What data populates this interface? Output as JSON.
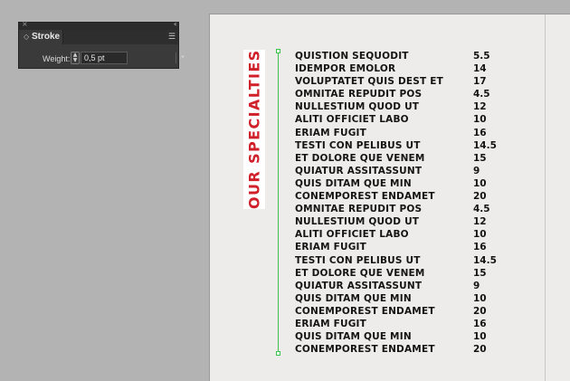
{
  "panel": {
    "title": "Stroke",
    "close_glyph": "×",
    "collapse_glyph": "‹‹",
    "tab_glyph": "◇",
    "menu_glyph": "☰",
    "weight_label": "Weight:",
    "stepper_up": "▲",
    "stepper_down": "▼",
    "weight_value": "0,5 pt",
    "dropdown_glyph": "▾"
  },
  "document": {
    "heading": "OUR SPECIALTIES",
    "heading_color": "#d0202a",
    "divider_color": "#3cc24a",
    "items": [
      {
        "name": "QUISTION SEQUODIT",
        "price": "5.5"
      },
      {
        "name": "IDEMPOR EMOLOR",
        "price": "14"
      },
      {
        "name": "VOLUPTATET QUIS DEST ET",
        "price": "17"
      },
      {
        "name": "OMNITAE REPUDIT POS",
        "price": "4.5"
      },
      {
        "name": "NULLESTIUM QUOD UT",
        "price": "12"
      },
      {
        "name": "ALITI OFFICIET LABO",
        "price": "10"
      },
      {
        "name": "ERIAM FUGIT",
        "price": "16"
      },
      {
        "name": "TESTI CON PELIBUS UT",
        "price": "14.5"
      },
      {
        "name": "ET DOLORE QUE VENEM",
        "price": "15"
      },
      {
        "name": "QUIATUR ASSITASSUNT",
        "price": "9"
      },
      {
        "name": "QUIS DITAM QUE MIN",
        "price": "10"
      },
      {
        "name": "CONEMPOREST ENDAMET",
        "price": "20"
      },
      {
        "name": "OMNITAE REPUDIT POS",
        "price": "4.5"
      },
      {
        "name": "NULLESTIUM QUOD UT",
        "price": "12"
      },
      {
        "name": "ALITI OFFICIET LABO",
        "price": "10"
      },
      {
        "name": "ERIAM FUGIT",
        "price": "16"
      },
      {
        "name": "TESTI CON PELIBUS UT",
        "price": "14.5"
      },
      {
        "name": "ET DOLORE QUE VENEM",
        "price": "15"
      },
      {
        "name": "QUIATUR ASSITASSUNT",
        "price": "9"
      },
      {
        "name": "QUIS DITAM QUE MIN",
        "price": "10"
      },
      {
        "name": "CONEMPOREST ENDAMET",
        "price": "20"
      },
      {
        "name": "ERIAM FUGIT",
        "price": "16"
      },
      {
        "name": "QUIS DITAM QUE MIN",
        "price": "10"
      },
      {
        "name": "CONEMPOREST ENDAMET",
        "price": "20"
      }
    ]
  }
}
